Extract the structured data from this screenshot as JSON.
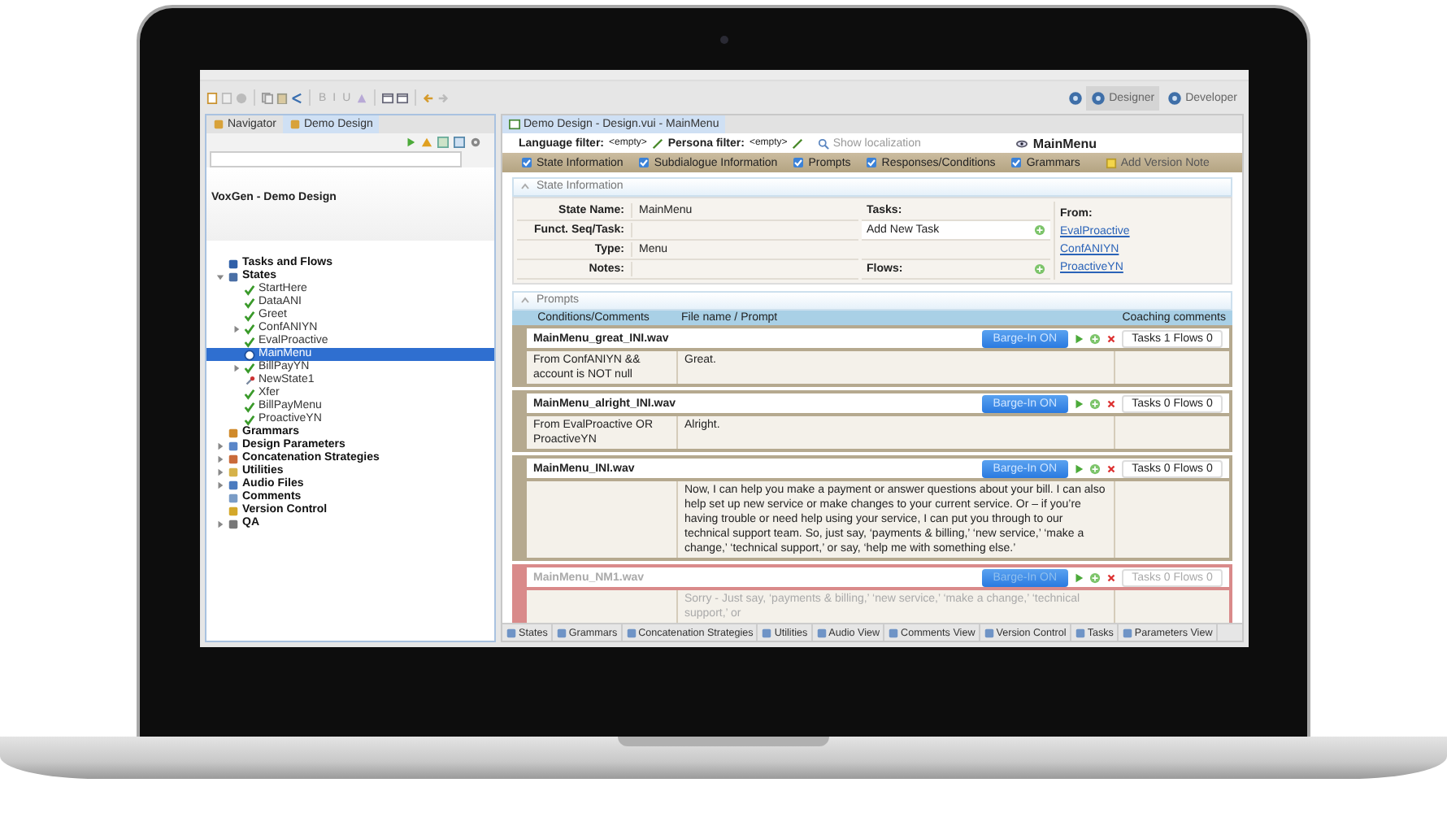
{
  "toolbar": {
    "format_buttons": [
      "B",
      "I",
      "U"
    ],
    "perspectives": [
      {
        "label": "Designer",
        "selected": true
      },
      {
        "label": "Developer",
        "selected": false
      }
    ]
  },
  "navigator": {
    "tabs": [
      {
        "label": "Navigator",
        "selected": false
      },
      {
        "label": "Demo Design",
        "selected": true
      }
    ],
    "project_title": "VoxGen - Demo Design",
    "tree": [
      {
        "label": "Tasks and Flows",
        "kind": "tasks",
        "selected": false
      },
      {
        "label": "States",
        "kind": "states",
        "selected": false,
        "expanded": true,
        "children": [
          {
            "label": "StartHere",
            "kind": "check",
            "selected": false
          },
          {
            "label": "DataANI",
            "kind": "check",
            "selected": false
          },
          {
            "label": "Greet",
            "kind": "check",
            "selected": false
          },
          {
            "label": "ConfANIYN",
            "kind": "check",
            "selected": false,
            "expanded": false
          },
          {
            "label": "EvalProactive",
            "kind": "check",
            "selected": false
          },
          {
            "label": "MainMenu",
            "kind": "state",
            "selected": true
          },
          {
            "label": "BillPayYN",
            "kind": "check",
            "selected": false,
            "expanded": false
          },
          {
            "label": "NewState1",
            "kind": "wrench",
            "selected": false
          },
          {
            "label": "Xfer",
            "kind": "check",
            "selected": false
          },
          {
            "label": "BillPayMenu",
            "kind": "check",
            "selected": false
          },
          {
            "label": "ProactiveYN",
            "kind": "check",
            "selected": false
          }
        ]
      },
      {
        "label": "Grammars",
        "kind": "grammars",
        "selected": false
      },
      {
        "label": "Design Parameters",
        "kind": "parameters",
        "selected": false,
        "expanded": false
      },
      {
        "label": "Concatenation Strategies",
        "kind": "strategies",
        "selected": false,
        "expanded": false
      },
      {
        "label": "Utilities",
        "kind": "utilities",
        "selected": false,
        "expanded": false
      },
      {
        "label": "Audio Files",
        "kind": "audio",
        "selected": false,
        "expanded": false
      },
      {
        "label": "Comments",
        "kind": "comments",
        "selected": false
      },
      {
        "label": "Version Control",
        "kind": "version",
        "selected": false
      },
      {
        "label": "QA",
        "kind": "qa",
        "selected": false,
        "expanded": false
      }
    ]
  },
  "editor": {
    "tab": "Demo Design - Design.vui - MainMenu",
    "language_filter": {
      "label": "Language filter:",
      "value": "<empty>"
    },
    "persona_filter": {
      "label": "Persona filter:",
      "value": "<empty>"
    },
    "show_localization": "Show localization",
    "state_title": "MainMenu",
    "sections": [
      {
        "label": "State Information",
        "checked": true
      },
      {
        "label": "Subdialogue Information",
        "checked": true
      },
      {
        "label": "Prompts",
        "checked": true
      },
      {
        "label": "Responses/Conditions",
        "checked": true
      },
      {
        "label": "Grammars",
        "checked": true
      }
    ],
    "add_version_note": "Add Version Note",
    "state_info": {
      "title": "State Information",
      "fields": [
        {
          "label": "State Name:",
          "value": "MainMenu"
        },
        {
          "label": "Funct. Seq/Task:"
        },
        {
          "label": "Type:",
          "value": "Menu"
        },
        {
          "label": "Notes:"
        }
      ],
      "tasks_label": "Tasks:",
      "add_task": "Add New Task",
      "flows_label": "Flows:",
      "from_label": "From:",
      "from_links": [
        "EvalProactive",
        "ConfANIYN",
        "ProactiveYN"
      ]
    },
    "prompts": {
      "title": "Prompts",
      "columns": [
        "Conditions/Comments",
        "File name / Prompt",
        "Coaching comments"
      ],
      "items": [
        {
          "file": "MainMenu_great_INI.wav",
          "barge_in": "Barge-In ON",
          "counts": "Tasks 1 Flows 0",
          "condition": "From ConfANIYN && account is NOT null",
          "prompt": "Great.",
          "disabled": false
        },
        {
          "file": "MainMenu_alright_INI.wav",
          "barge_in": "Barge-In ON",
          "counts": "Tasks 0 Flows 0",
          "condition": "From EvalProactive OR ProactiveYN",
          "prompt": "Alright.",
          "disabled": false
        },
        {
          "file": "MainMenu_INI.wav",
          "barge_in": "Barge-In ON",
          "counts": "Tasks 0 Flows 0",
          "prompt": "Now, I can help you make a payment or answer questions about your bill.  I can also help set up new service or make changes to your current service.  Or – if you’re having trouble or need help using your service, I can put you through to our technical support team.  So, just say, ‘payments & billing,’ ‘new service,’ ‘make a change,’ ‘technical support,’ or say, ‘help me with something else.’",
          "disabled": false
        },
        {
          "file": "MainMenu_NM1.wav",
          "barge_in": "Barge-In ON",
          "counts": "Tasks 0 Flows 0",
          "prompt": "Sorry - Just say, ‘payments & billing,’ ‘new service,’ ‘make a change,’ ‘technical support,’ or",
          "disabled": true
        }
      ]
    }
  },
  "bottom_tabs": [
    "States",
    "Grammars",
    "Concatenation Strategies",
    "Utilities",
    "Audio View",
    "Comments View",
    "Version Control",
    "Tasks",
    "Parameters View"
  ]
}
